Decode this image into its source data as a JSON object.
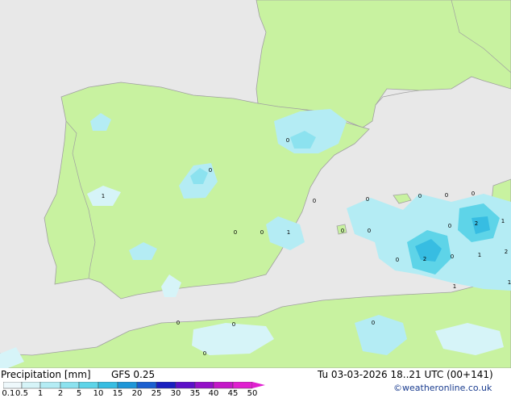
{
  "footer": {
    "title_text": "Precipitation [mm]",
    "model": "GFS 0.25",
    "time_text": "Tu 03-03-2026 18..21 UTC (00+141)",
    "credit": "©weatheronline.co.uk"
  },
  "legend": {
    "ticks": [
      "0.1",
      "0.5",
      "1",
      "2",
      "5",
      "10",
      "15",
      "20",
      "25",
      "30",
      "35",
      "40",
      "45",
      "50"
    ],
    "colors": [
      "#eef8fb",
      "#d6f4f8",
      "#b4ecf4",
      "#8ce2ef",
      "#5ed4e8",
      "#37bde2",
      "#1e96d8",
      "#1a5fd0",
      "#1a1fc0",
      "#5c10c8",
      "#9410c8",
      "#c418c8",
      "#e020d0"
    ]
  },
  "map_colors": {
    "sea": "#e8e8e8",
    "land": "#c8f2a0",
    "border": "#a0a0a0"
  },
  "cell_labels": [
    "0",
    "1",
    "0",
    "0",
    "0",
    "1",
    "0",
    "0",
    "0",
    "0",
    "0",
    "0",
    "0",
    "2",
    "1",
    "0",
    "1",
    "2",
    "0",
    "1",
    "2",
    "0",
    "1",
    "0",
    "0",
    "0",
    "0"
  ]
}
